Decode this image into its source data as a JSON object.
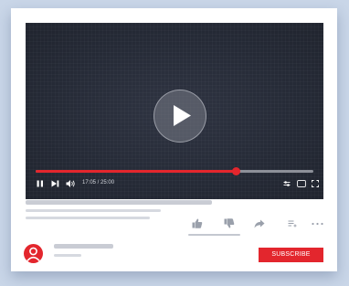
{
  "player": {
    "time_display": "17:05 / 25:00",
    "progress_fraction": 0.72
  },
  "channel": {
    "subscribe_label": "SUBSCRIBE"
  },
  "colors": {
    "accent": "#e3262d",
    "player_bg": "#262b37",
    "page_bg": "#c9d6e8"
  },
  "icons": [
    "play-icon",
    "pause-icon",
    "skip-next-icon",
    "volume-icon",
    "settings-icon",
    "miniplayer-icon",
    "fullscreen-icon",
    "thumbs-up-icon",
    "thumbs-down-icon",
    "share-icon",
    "add-to-playlist-icon",
    "more-icon",
    "user-icon"
  ]
}
